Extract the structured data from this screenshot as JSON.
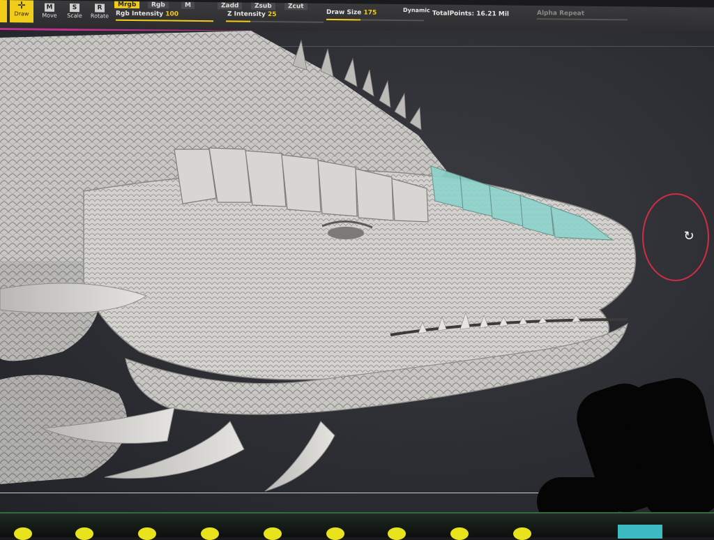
{
  "toolbar": {
    "edit_label": "",
    "draw_label": "Draw",
    "move_label": "Move",
    "move_key": "M",
    "scale_label": "Scale",
    "scale_key": "S",
    "rotate_label": "Rotate",
    "rotate_key": "R",
    "mrgb_label": "Mrgb",
    "rgb_label": "Rgb",
    "m_label": "M",
    "rgb_intensity_label": "Rgb Intensity",
    "rgb_intensity_value": "100",
    "zadd_label": "Zadd",
    "zsub_label": "Zsub",
    "zcut_label": "Zcut",
    "z_intensity_label": "Z Intensity",
    "z_intensity_value": "25",
    "draw_size_label": "Draw Size",
    "draw_size_value": "175",
    "dynamic_label": "Dynamic",
    "total_points_label": "TotalPoints:",
    "total_points_value": "16.21 Mil",
    "alpha_repeat_label": "Alpha Repeat",
    "rgb_intensity_fill": 1.0,
    "z_intensity_fill": 0.25,
    "draw_size_fill": 0.35
  },
  "viewport": {
    "model": "dragon-head-sculpt",
    "rotate_icon": "rotate-icon"
  },
  "colors": {
    "accent_yellow": "#f1cd1a",
    "toolbar_border": "#c0308f",
    "ring_red": "#d62b45",
    "mask_teal": "#8fd3cc",
    "bottom_dot": "#e9e31d",
    "corner_btn": "#3db9c2"
  }
}
